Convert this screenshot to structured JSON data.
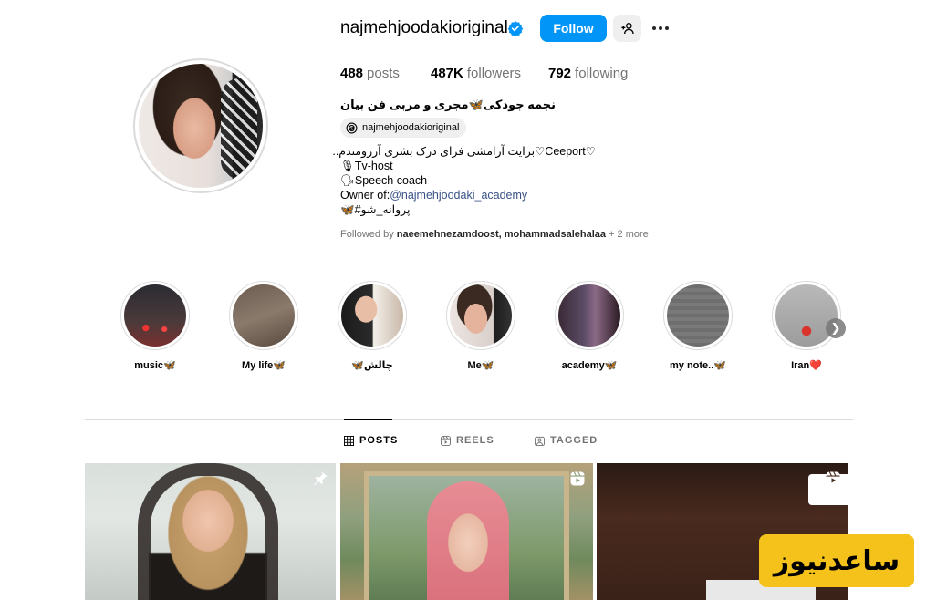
{
  "profile": {
    "username": "najmehjoodakioriginal",
    "follow_label": "Follow",
    "stats": {
      "posts_count": "488",
      "posts_label": "posts",
      "followers_count": "487K",
      "followers_label": "followers",
      "following_count": "792",
      "following_label": "following"
    },
    "full_name": "نجمه جودکی🦋مجری و مربی فن بیان",
    "threads_handle": "najmehjoodakioriginal",
    "bio": {
      "line1": "♡Ceeport♡برایت آرامشی فرای درک بشری آرزومندم..",
      "line2": "🎙Tv-host",
      "line3": "🗣Speech coach",
      "line4_prefix": "Owner of:",
      "line4_link": "@najmehjoodaki_academy",
      "line5": "🦋#پروانه_شو"
    },
    "followed_by": {
      "prefix": "Followed by",
      "names": "naeemehnezamdoost, mohammadsalehalaa",
      "more": "+ 2 more"
    }
  },
  "highlights": [
    {
      "label": "music🦋"
    },
    {
      "label": "My life🦋"
    },
    {
      "label": "🦋چالش"
    },
    {
      "label": "Me🦋"
    },
    {
      "label": "academy🦋"
    },
    {
      "label": "my note..🦋"
    },
    {
      "label": "Iran❤️"
    }
  ],
  "tabs": [
    {
      "label": "POSTS"
    },
    {
      "label": "REELS"
    },
    {
      "label": "TAGGED"
    }
  ],
  "watermark": "ساعدنیوز",
  "colors": {
    "accent": "#0095f6",
    "link": "#385185",
    "muted_text": "#737373",
    "divider": "#dbdbdb",
    "watermark_bg": "#f5c21b"
  },
  "icons": [
    "verified-badge-icon",
    "add-user-icon",
    "more-options-icon",
    "threads-icon",
    "grid-icon",
    "reels-icon",
    "tagged-icon",
    "pin-icon",
    "reel-post-icon",
    "chevron-right-icon"
  ]
}
